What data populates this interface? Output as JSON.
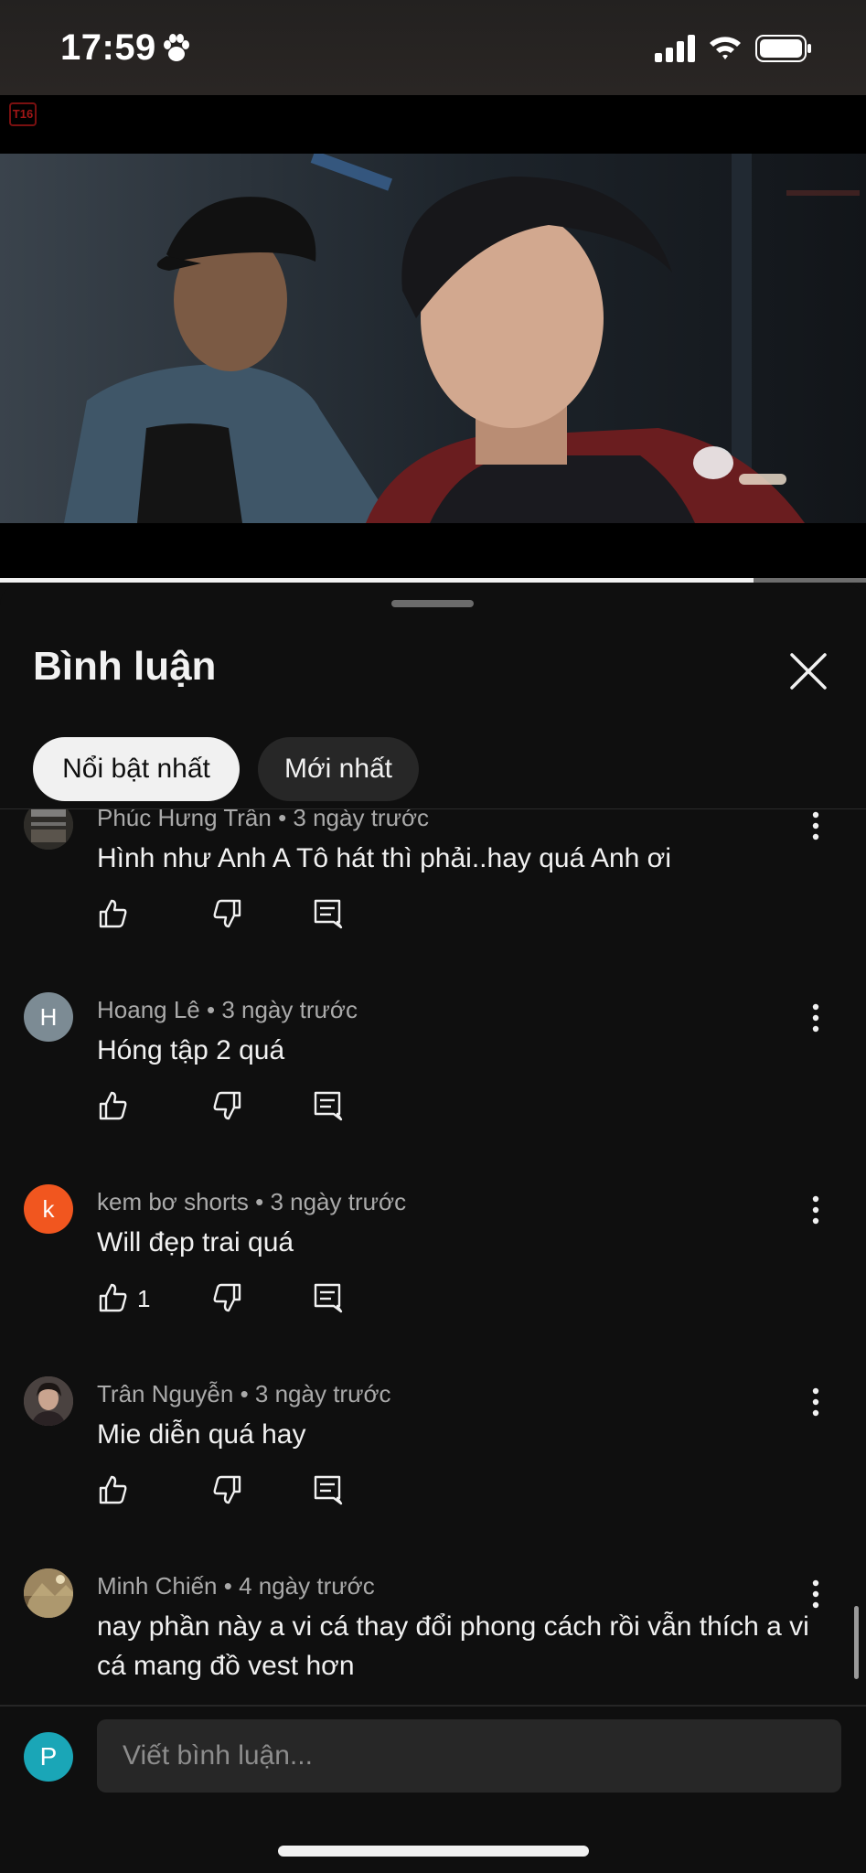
{
  "status_bar": {
    "time": "17:59"
  },
  "video": {
    "age_rating": "T16",
    "progress_fraction": 0.87
  },
  "comments_panel": {
    "title": "Bình luận",
    "chips": [
      {
        "label": "Nổi bật nhất",
        "selected": true
      },
      {
        "label": "Mới nhất",
        "selected": false
      }
    ],
    "comments": [
      {
        "author": "Phúc Hưng Trân",
        "time": "3 ngày trước",
        "text": "Hình như Anh A Tô hát thì phải..hay quá Anh ơi",
        "likes": "",
        "avatar_letter": "",
        "avatar_color": "#3b3a36"
      },
      {
        "author": "Hoang Lê",
        "time": "3 ngày trước",
        "text": "Hóng tập 2 quá",
        "likes": "",
        "avatar_letter": "H",
        "avatar_color": "#7c8b94"
      },
      {
        "author": "kem bơ shorts",
        "time": "3 ngày trước",
        "text": "Will đẹp trai quá",
        "likes": "1",
        "avatar_letter": "k",
        "avatar_color": "#f1561f"
      },
      {
        "author": "Trân Nguyễn",
        "time": "3 ngày trước",
        "text": "Mie diễn quá hay",
        "likes": "",
        "avatar_letter": "",
        "avatar_color": "#6b5a55"
      },
      {
        "author": "Minh Chiến",
        "time": "4 ngày trước",
        "text": "nay phần này a vi cá thay đổi phong cách rồi vẫn thích a vi cá mang đồ vest hơn",
        "likes": "",
        "avatar_letter": "",
        "avatar_color": "#b49a6e"
      }
    ],
    "input": {
      "placeholder": "Viết bình luận...",
      "value": "",
      "user_initial": "P"
    }
  },
  "colors": {
    "background": "#0f0f0f",
    "chip_active": "#f1f1f1",
    "chip_inactive": "#272727",
    "meta_text": "#aaaaaa",
    "user_avatar": "#1aa6b7"
  }
}
